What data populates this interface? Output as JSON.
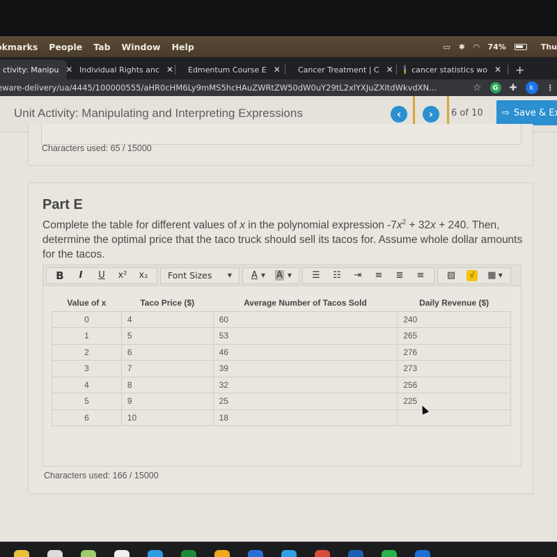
{
  "menubar": {
    "items": [
      "okmarks",
      "People",
      "Tab",
      "Window",
      "Help"
    ],
    "battery": "74%",
    "clock": "Thu"
  },
  "tabs": [
    {
      "label": "ctivity: Manipu",
      "active": true
    },
    {
      "label": "Individual Rights anc",
      "active": false
    },
    {
      "label": "Edmentum Course E",
      "active": false
    },
    {
      "label": "Cancer Treatment | C",
      "active": false
    },
    {
      "label": "cancer statistics wo",
      "active": false
    }
  ],
  "new_tab": "+",
  "url": "eware-delivery/ua/4445/100000555/aHR0cHM6Ly9mMS5hcHAuZWRtZW50dW0uY29tL2xlYXJuZXItdWkvdXN...",
  "profile_initial": "k",
  "extension_initial": "G",
  "header": {
    "title": "Unit Activity: Manipulating and Interpreting Expressions",
    "prev": "‹",
    "next": "›",
    "page_count": "6 of 10",
    "save_label": "Save & Ex"
  },
  "prev_card": {
    "chars_used": "Characters used: 65 / 15000"
  },
  "part_e": {
    "title": "Part E",
    "prompt_1": "Complete the table for different values of ",
    "prompt_var": "x",
    "prompt_2": " in the polynomial expression -7",
    "prompt_var2": "x",
    "prompt_sup": "2",
    "prompt_3": " + 32",
    "prompt_var3": "x",
    "prompt_4": " + 240. Then, determine the optimal price that the taco truck should sell its tacos for. Assume whole dollar amounts for the tacos.",
    "chars_used": "Characters used: 166 / 15000"
  },
  "toolbar": {
    "bold": "B",
    "italic": "I",
    "underline": "U",
    "superscript": "x²",
    "subscript": "x₂",
    "font_sizes": "Font Sizes",
    "font_color": "A",
    "bg_color": "A"
  },
  "table": {
    "headers": [
      "Value of x",
      "Taco Price ($)",
      "Average Number of Tacos Sold",
      "Daily Revenue ($)"
    ],
    "rows": [
      [
        "0",
        "4",
        "60",
        "240"
      ],
      [
        "1",
        "5",
        "53",
        "265"
      ],
      [
        "2",
        "6",
        "46",
        "276"
      ],
      [
        "3",
        "7",
        "39",
        "273"
      ],
      [
        "4",
        "8",
        "32",
        "256"
      ],
      [
        "5",
        "9",
        "25",
        "225"
      ],
      [
        "6",
        "10",
        "18",
        ""
      ]
    ]
  }
}
